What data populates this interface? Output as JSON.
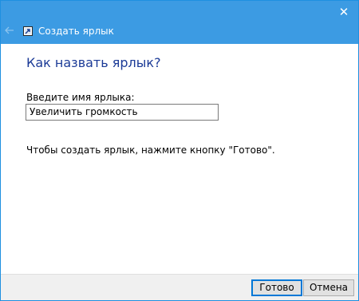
{
  "window": {
    "title": "Создать ярлык",
    "close_glyph": "✕",
    "accent_color": "#3c9be3"
  },
  "content": {
    "heading": "Как назвать ярлык?",
    "name_label": "Введите имя ярлыка:",
    "name_value": "Увеличить громкость",
    "hint": "Чтобы создать ярлык, нажмите кнопку \"Готово\"."
  },
  "footer": {
    "finish_label": "Готово",
    "cancel_label": "Отмена"
  },
  "icons": {
    "back": "back-arrow-icon",
    "app": "shortcut-wizard-icon",
    "close": "close-icon"
  }
}
